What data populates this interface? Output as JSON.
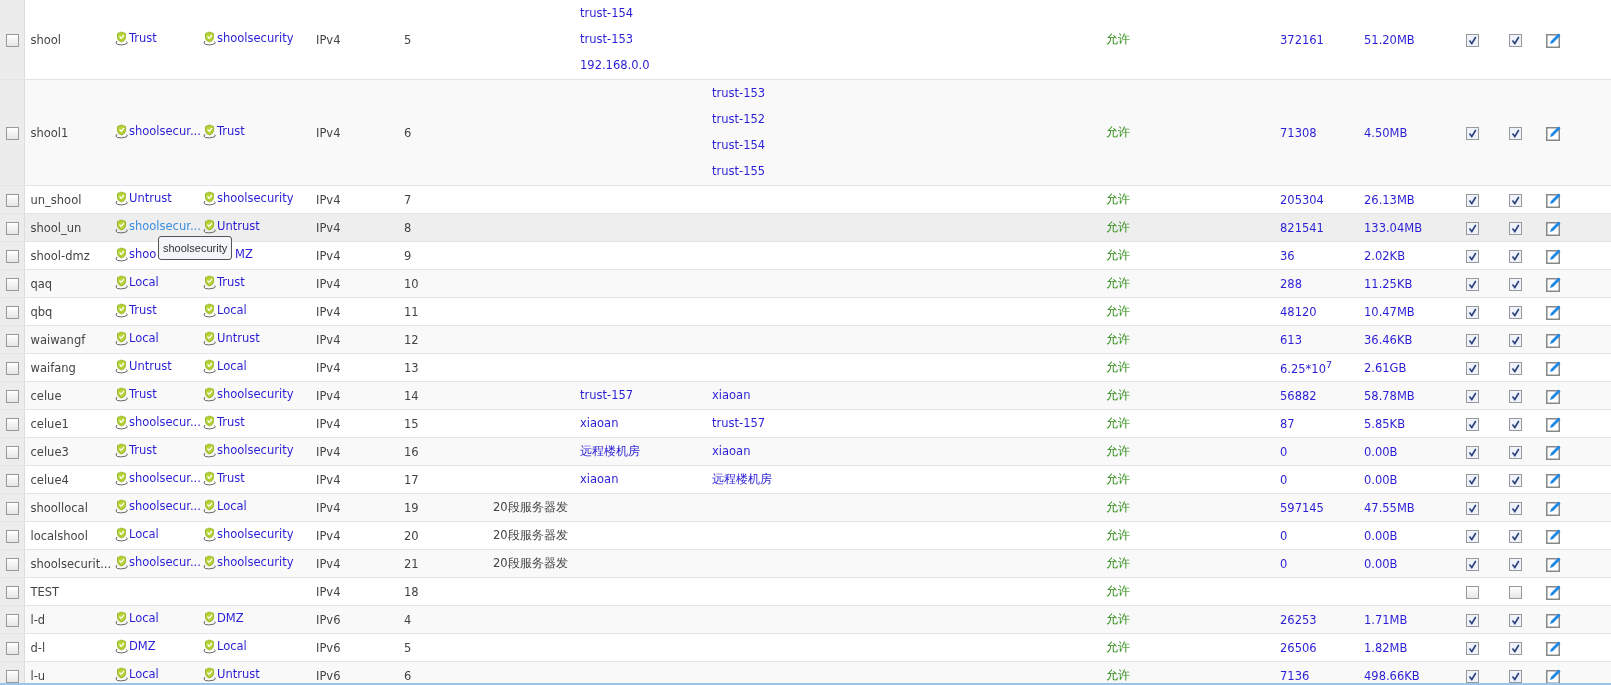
{
  "rows": [
    {
      "selected": false,
      "hovered": false,
      "name": "shool",
      "src_zone": {
        "text": "Trust",
        "icon": true
      },
      "dst_zone": {
        "text": "shoolsecurity",
        "icon": true
      },
      "ip_version": "IPv4",
      "id": "5",
      "src_addresses": [
        "trust-154",
        "trust-153",
        "192.168.0.0"
      ],
      "action": "允许",
      "hits": "372161",
      "bytes": "51.20MB",
      "checkbox_1": true,
      "checkbox_2": true
    },
    {
      "selected": false,
      "hovered": false,
      "name": "shool1",
      "src_zone": {
        "text": "shoolsecur...",
        "icon": true
      },
      "dst_zone": {
        "text": "Trust",
        "icon": true
      },
      "ip_version": "IPv4",
      "id": "6",
      "dst_addresses": [
        "trust-153",
        "trust-152",
        "trust-154",
        "trust-155"
      ],
      "action": "允许",
      "hits": "71308",
      "bytes": "4.50MB",
      "checkbox_1": true,
      "checkbox_2": true
    },
    {
      "selected": false,
      "hovered": false,
      "name": "un_shool",
      "src_zone": {
        "text": "Untrust",
        "icon": true
      },
      "dst_zone": {
        "text": "shoolsecurity",
        "icon": true
      },
      "ip_version": "IPv4",
      "id": "7",
      "action": "允许",
      "hits": "205304",
      "bytes": "26.13MB",
      "checkbox_1": true,
      "checkbox_2": true
    },
    {
      "selected": false,
      "hovered": true,
      "name": "shool_un",
      "src_zone": {
        "text": "shoolsecur...",
        "icon": true
      },
      "dst_zone": {
        "text": "Untrust",
        "icon": true
      },
      "ip_version": "IPv4",
      "id": "8",
      "action": "允许",
      "hits": "821541",
      "bytes": "133.04MB",
      "checkbox_1": true,
      "checkbox_2": true,
      "tooltip": "shoolsecurity"
    },
    {
      "selected": false,
      "hovered": false,
      "name": "shool-dmz",
      "src_zone": {
        "text": "shoo",
        "icon": true
      },
      "dst_zone": {
        "text": "MZ",
        "icon": false
      },
      "ip_version": "IPv4",
      "id": "9",
      "action": "允许",
      "hits": "36",
      "bytes": "2.02KB",
      "checkbox_1": true,
      "checkbox_2": true
    },
    {
      "selected": false,
      "hovered": false,
      "name": "qaq",
      "src_zone": {
        "text": "Local",
        "icon": true
      },
      "dst_zone": {
        "text": "Trust",
        "icon": true
      },
      "ip_version": "IPv4",
      "id": "10",
      "action": "允许",
      "hits": "288",
      "bytes": "11.25KB",
      "checkbox_1": true,
      "checkbox_2": true
    },
    {
      "selected": false,
      "hovered": false,
      "name": "qbq",
      "src_zone": {
        "text": "Trust",
        "icon": true
      },
      "dst_zone": {
        "text": "Local",
        "icon": true
      },
      "ip_version": "IPv4",
      "id": "11",
      "action": "允许",
      "hits": "48120",
      "bytes": "10.47MB",
      "checkbox_1": true,
      "checkbox_2": true
    },
    {
      "selected": false,
      "hovered": false,
      "name": "waiwangf",
      "src_zone": {
        "text": "Local",
        "icon": true
      },
      "dst_zone": {
        "text": "Untrust",
        "icon": true
      },
      "ip_version": "IPv4",
      "id": "12",
      "action": "允许",
      "hits": "613",
      "bytes": "36.46KB",
      "checkbox_1": true,
      "checkbox_2": true
    },
    {
      "selected": false,
      "hovered": false,
      "name": "waifang",
      "src_zone": {
        "text": "Untrust",
        "icon": true
      },
      "dst_zone": {
        "text": "Local",
        "icon": true
      },
      "ip_version": "IPv4",
      "id": "13",
      "action": "允许",
      "hits": "6.25*10$^{7}$",
      "bytes": "2.61GB",
      "checkbox_1": true,
      "checkbox_2": true
    },
    {
      "selected": false,
      "hovered": false,
      "name": "celue",
      "src_zone": {
        "text": "Trust",
        "icon": true
      },
      "dst_zone": {
        "text": "shoolsecurity",
        "icon": true
      },
      "ip_version": "IPv4",
      "id": "14",
      "src_addresses": [
        "trust-157"
      ],
      "dst_addresses": [
        "xiaoan"
      ],
      "action": "允许",
      "hits": "56882",
      "bytes": "58.78MB",
      "checkbox_1": true,
      "checkbox_2": true
    },
    {
      "selected": false,
      "hovered": false,
      "name": "celue1",
      "src_zone": {
        "text": "shoolsecur...",
        "icon": true
      },
      "dst_zone": {
        "text": "Trust",
        "icon": true
      },
      "ip_version": "IPv4",
      "id": "15",
      "src_addresses": [
        "xiaoan"
      ],
      "dst_addresses": [
        "trust-157"
      ],
      "action": "允许",
      "hits": "87",
      "bytes": "5.85KB",
      "checkbox_1": true,
      "checkbox_2": true
    },
    {
      "selected": false,
      "hovered": false,
      "name": "celue3",
      "src_zone": {
        "text": "Trust",
        "icon": true
      },
      "dst_zone": {
        "text": "shoolsecurity",
        "icon": true
      },
      "ip_version": "IPv4",
      "id": "16",
      "src_addresses": [
        "远程楼机房"
      ],
      "dst_addresses": [
        "xiaoan"
      ],
      "action": "允许",
      "hits": "0",
      "bytes": "0.00B",
      "checkbox_1": true,
      "checkbox_2": true
    },
    {
      "selected": false,
      "hovered": false,
      "name": "celue4",
      "src_zone": {
        "text": "shoolsecur...",
        "icon": true
      },
      "dst_zone": {
        "text": "Trust",
        "icon": true
      },
      "ip_version": "IPv4",
      "id": "17",
      "src_addresses": [
        "xiaoan"
      ],
      "dst_addresses": [
        "远程楼机房"
      ],
      "action": "允许",
      "hits": "0",
      "bytes": "0.00B",
      "checkbox_1": true,
      "checkbox_2": true
    },
    {
      "selected": false,
      "hovered": false,
      "name": "shoollocal",
      "src_zone": {
        "text": "shoolsecur...",
        "icon": true
      },
      "dst_zone": {
        "text": "Local",
        "icon": true
      },
      "ip_version": "IPv4",
      "id": "19",
      "column_6": "20段服务器发",
      "action": "允许",
      "hits": "597145",
      "bytes": "47.55MB",
      "checkbox_1": true,
      "checkbox_2": true
    },
    {
      "selected": false,
      "hovered": false,
      "name": "localshool",
      "src_zone": {
        "text": "Local",
        "icon": true
      },
      "dst_zone": {
        "text": "shoolsecurity",
        "icon": true
      },
      "ip_version": "IPv4",
      "id": "20",
      "column_6": "20段服务器发",
      "action": "允许",
      "hits": "0",
      "bytes": "0.00B",
      "checkbox_1": true,
      "checkbox_2": true
    },
    {
      "selected": false,
      "hovered": false,
      "name": "shoolsecurit...",
      "src_zone": {
        "text": "shoolsecur...",
        "icon": true
      },
      "dst_zone": {
        "text": "shoolsecurity",
        "icon": true
      },
      "ip_version": "IPv4",
      "id": "21",
      "column_6": "20段服务器发",
      "action": "允许",
      "hits": "0",
      "bytes": "0.00B",
      "checkbox_1": true,
      "checkbox_2": true
    },
    {
      "selected": false,
      "hovered": false,
      "name": "TEST",
      "ip_version": "IPv4",
      "id": "18",
      "action": "允许",
      "checkbox_1": false,
      "checkbox_2": false
    },
    {
      "selected": false,
      "hovered": false,
      "name": "l-d",
      "src_zone": {
        "text": "Local",
        "icon": true
      },
      "dst_zone": {
        "text": "DMZ",
        "icon": true
      },
      "ip_version": "IPv6",
      "id": "4",
      "action": "允许",
      "hits": "26253",
      "bytes": "1.71MB",
      "checkbox_1": true,
      "checkbox_2": true
    },
    {
      "selected": false,
      "hovered": false,
      "name": "d-l",
      "src_zone": {
        "text": "DMZ",
        "icon": true
      },
      "dst_zone": {
        "text": "Local",
        "icon": true
      },
      "ip_version": "IPv6",
      "id": "5",
      "action": "允许",
      "hits": "26506",
      "bytes": "1.82MB",
      "checkbox_1": true,
      "checkbox_2": true
    },
    {
      "selected": false,
      "hovered": false,
      "name": "l-u",
      "src_zone": {
        "text": "Local",
        "icon": true
      },
      "dst_zone": {
        "text": "Untrust",
        "icon": true
      },
      "ip_version": "IPv6",
      "id": "6",
      "action": "允许",
      "hits": "7136",
      "bytes": "498.66KB",
      "checkbox_1": true,
      "checkbox_2": true
    }
  ]
}
